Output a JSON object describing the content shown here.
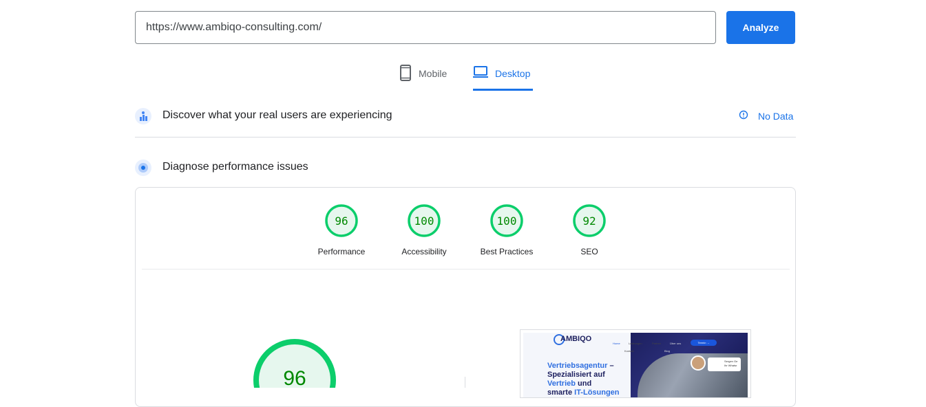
{
  "search": {
    "value": "https://www.ambiqo-consulting.com/",
    "button_label": "Analyze"
  },
  "tabs": [
    {
      "label": "Mobile",
      "icon": "smartphone-icon",
      "selected": false
    },
    {
      "label": "Desktop",
      "icon": "laptop-icon",
      "selected": true
    }
  ],
  "field_data": {
    "title": "Discover what your real users are experiencing",
    "status": "No Data",
    "icon": "users-chart-icon",
    "status_icon": "info-icon"
  },
  "lab_data": {
    "title": "Diagnose performance issues",
    "icon": "target-icon"
  },
  "scores": [
    {
      "label": "Performance",
      "value": "96"
    },
    {
      "label": "Accessibility",
      "value": "100"
    },
    {
      "label": "Best Practices",
      "value": "100"
    },
    {
      "label": "SEO",
      "value": "92"
    }
  ],
  "main_score": {
    "value": "96"
  },
  "colors": {
    "accent": "#1a73e8",
    "pass": "#0cce6b",
    "pass_text": "#008800",
    "pass_fill": "#e6f7ee"
  },
  "screenshot": {
    "logo": "AMBIQO",
    "nav": [
      "Home",
      "Leistungen",
      "Partner",
      "Über uns",
      "Kontakt",
      "Blog"
    ],
    "cta": "Termin →",
    "badge": "Sergen Ge Ihr Whatsr",
    "headline_1": "Vertriebsagentur",
    "headline_2": " –",
    "headline_3": "Spezialisiert auf",
    "headline_4": "Vertrieb",
    "headline_5": " und",
    "headline_6": "smarte ",
    "headline_7": "IT-Lösungen"
  }
}
